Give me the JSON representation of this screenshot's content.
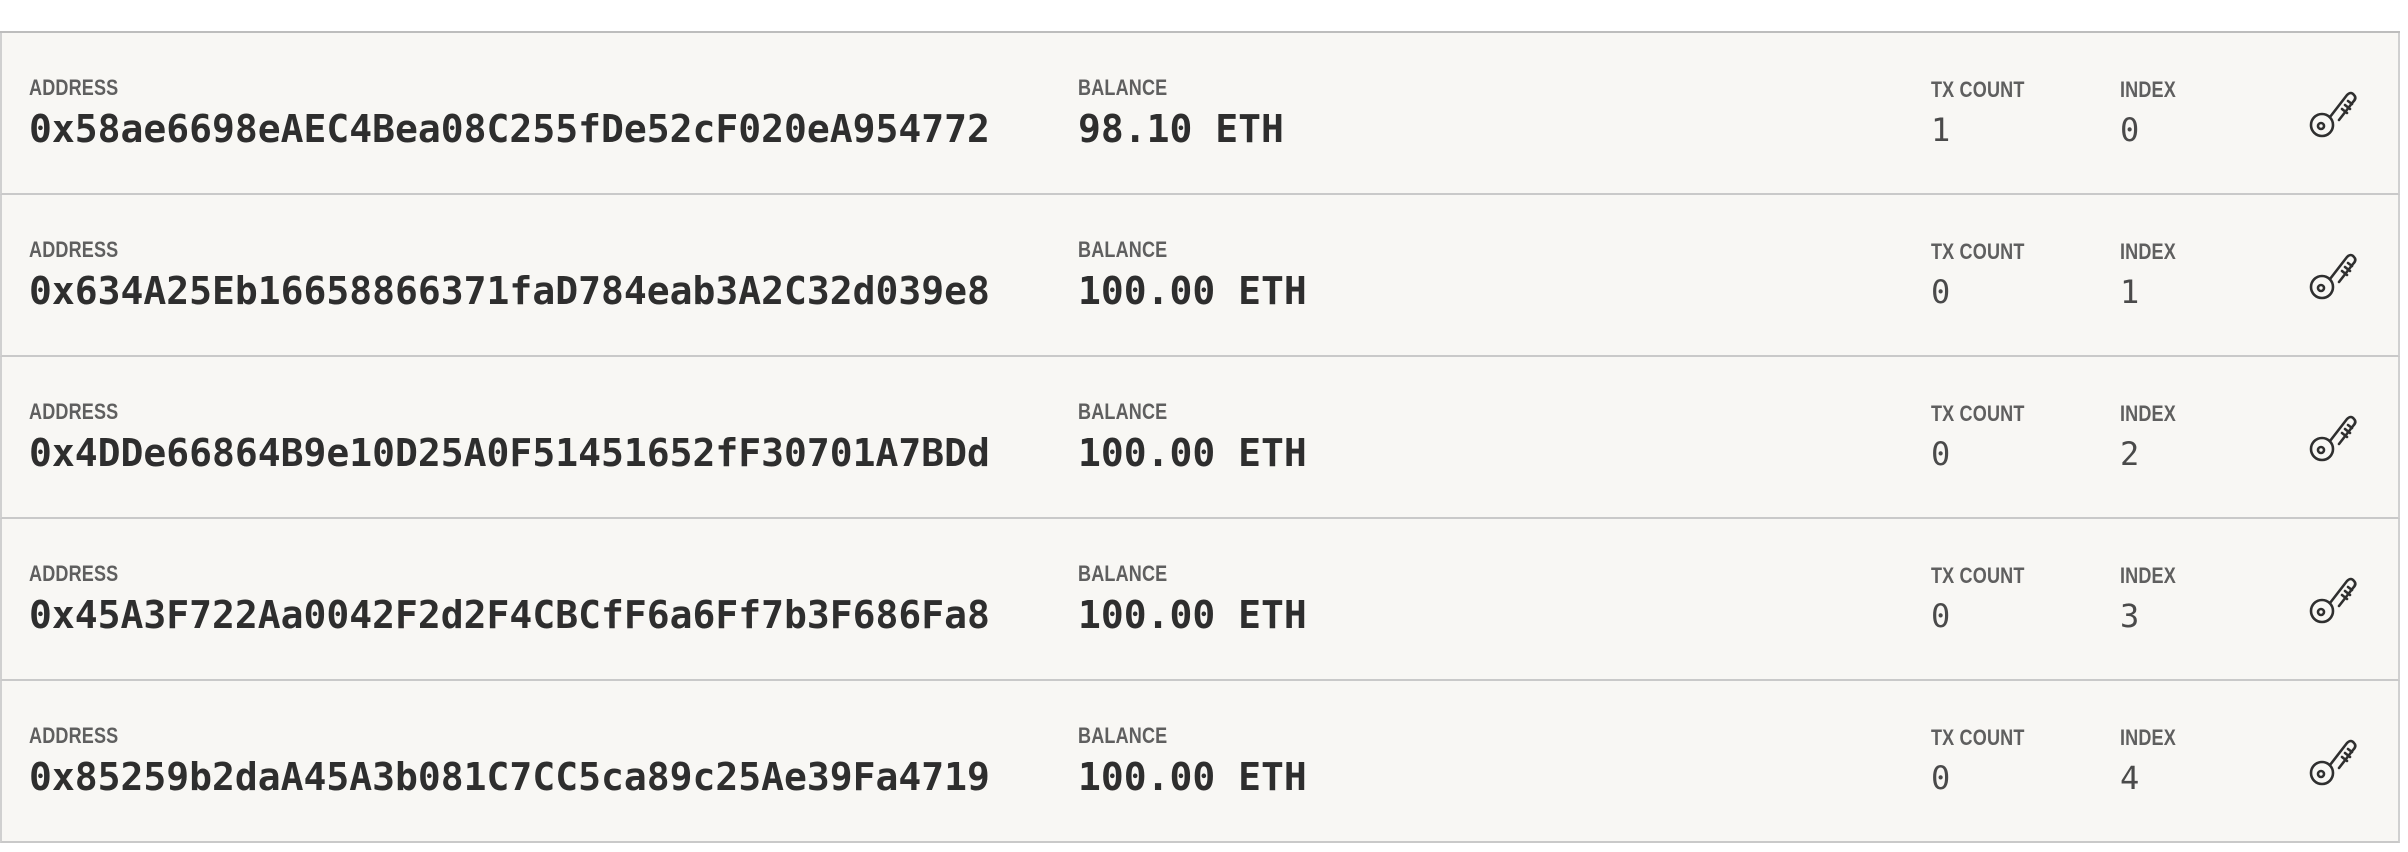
{
  "labels": {
    "address": "ADDRESS",
    "balance": "BALANCE",
    "tx_count": "TX COUNT",
    "index": "INDEX"
  },
  "accounts": [
    {
      "address": "0x58ae6698eAEC4Bea08C255fDe52cF020eA954772",
      "balance": "98.10 ETH",
      "tx_count": "1",
      "index": "0"
    },
    {
      "address": "0x634A25Eb16658866371faD784eab3A2C32d039e8",
      "balance": "100.00 ETH",
      "tx_count": "0",
      "index": "1"
    },
    {
      "address": "0x4DDe66864B9e10D25A0F51451652fF30701A7BDd",
      "balance": "100.00 ETH",
      "tx_count": "0",
      "index": "2"
    },
    {
      "address": "0x45A3F722Aa0042F2d2F4CBCfF6a6Ff7b3F686Fa8",
      "balance": "100.00 ETH",
      "tx_count": "0",
      "index": "3"
    },
    {
      "address": "0x85259b2daA45A3b081C7CC5ca89c25Ae39Fa4719",
      "balance": "100.00 ETH",
      "tx_count": "0",
      "index": "4"
    }
  ],
  "icons": {
    "show_keys": "key-icon"
  },
  "colors": {
    "row_background": "#f8f7f4",
    "text": "#2e2e2e",
    "label": "#5f5f5f"
  }
}
